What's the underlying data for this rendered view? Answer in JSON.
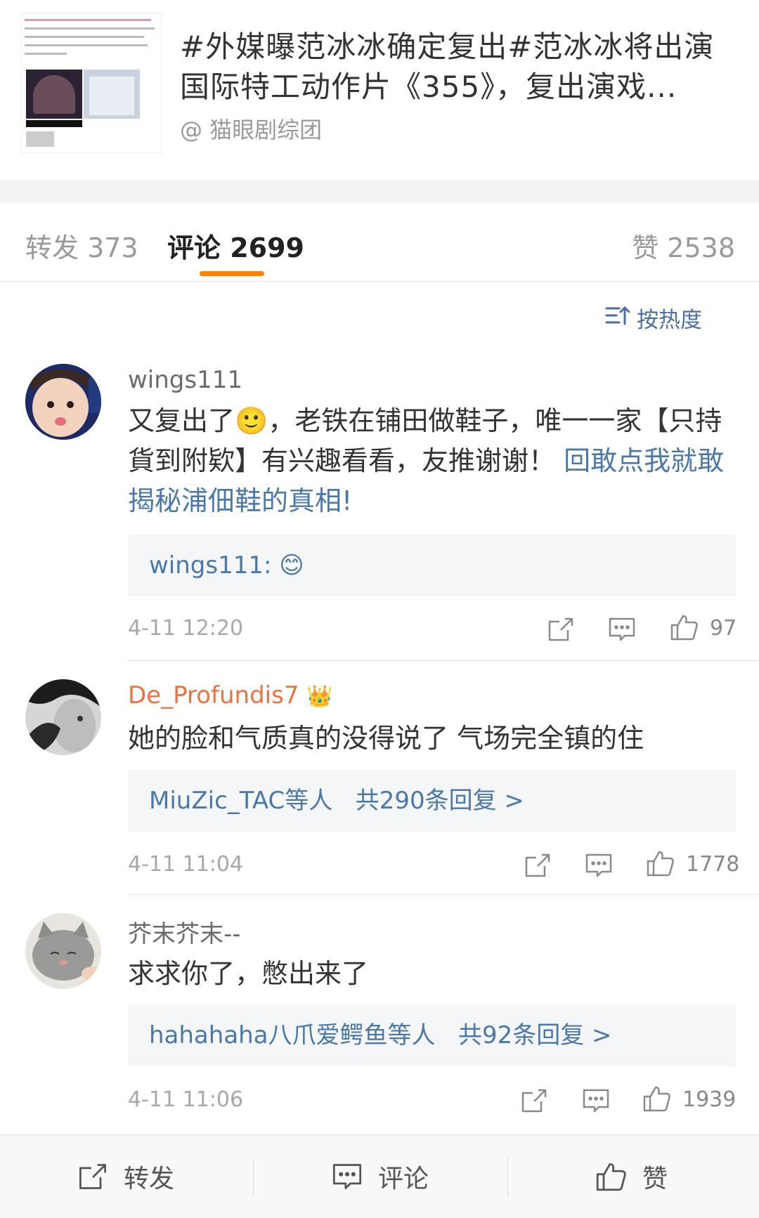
{
  "post": {
    "title": "#外媒曝范冰冰确定复出#范冰冰将出演国际特工动作片《355》，复出演戏...",
    "source": "@ 猫眼剧综团"
  },
  "tabs": {
    "repost": "转发 373",
    "comment": "评论 2699",
    "like": "赞 2538"
  },
  "sort_label": "按热度",
  "comments": [
    {
      "user": "wings111",
      "text_plain": "又复出了",
      "emoji": "🙂",
      "text_rest": "，老铁在铺田做鞋子，唯一一家【只持貨到附欵】有兴趣看看，友推谢谢！",
      "link_icon": "回",
      "link_text": "敢点我就敢揭秘浦佃鞋的真相!",
      "reply_user": "wings111:",
      "reply_emoji": "😊",
      "time": "4-11 12:20",
      "likes": "97"
    },
    {
      "user": "De_Profundis7",
      "badge_icon": "👑",
      "text": "她的脸和气质真的没得说了 气场完全镇的住",
      "reply_users": "MiuZic_TAC等人",
      "reply_count": "共290条回复 >",
      "time": "4-11 11:04",
      "likes": "1778"
    },
    {
      "user": "芥末芥末--",
      "text": "求求你了，憋出来了",
      "reply_users": "hahahaha八爪爱鳄鱼等人",
      "reply_count": "共92条回复 >",
      "time": "4-11 11:06",
      "likes": "1939"
    }
  ],
  "bottom": {
    "repost": "转发",
    "comment": "评论",
    "like": "赞"
  },
  "colors": {
    "accent": "#ff8200",
    "link": "#4a78a8",
    "vip_name": "#eb7340"
  }
}
